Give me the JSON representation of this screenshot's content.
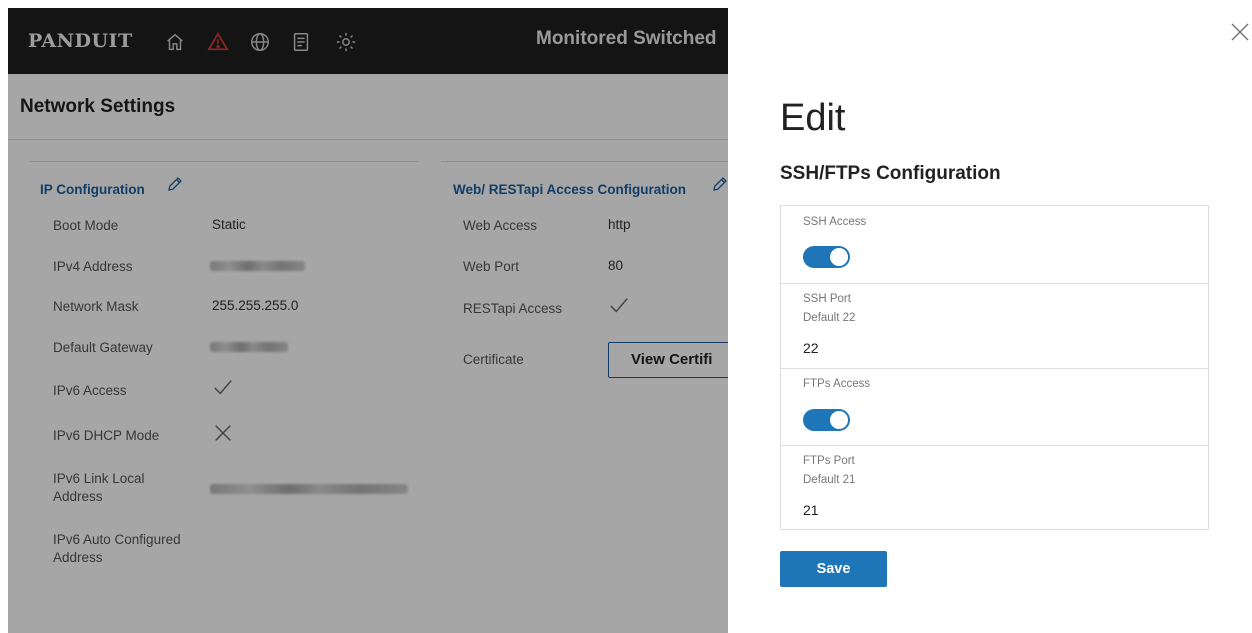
{
  "app": {
    "brand": "PANDUIT",
    "title": "Monitored Switched",
    "nav_icons": [
      "home-icon",
      "alert-icon",
      "globe-icon",
      "document-icon",
      "settings-icon"
    ],
    "alert_color": "#e53935"
  },
  "page": {
    "title": "Network Settings"
  },
  "ip_configuration": {
    "title": "IP Configuration",
    "rows": [
      {
        "label": "Boot Mode",
        "value": "Static"
      },
      {
        "label": "IPv4 Address",
        "value": ""
      },
      {
        "label": "Network Mask",
        "value": "255.255.255.0"
      },
      {
        "label": "Default Gateway",
        "value": ""
      },
      {
        "label": "IPv6 Access",
        "value": "check-icon"
      },
      {
        "label": "IPv6 DHCP Mode",
        "value": "cross-icon"
      },
      {
        "label": "IPv6 Link Local Address",
        "value": ""
      },
      {
        "label": "IPv6 Auto Configured Address",
        "value": ""
      }
    ]
  },
  "web_access": {
    "title": "Web/ RESTapi Access Configuration",
    "rows": [
      {
        "label": "Web Access",
        "value": "http"
      },
      {
        "label": "Web Port",
        "value": "80"
      },
      {
        "label": "RESTapi Access",
        "value": "check-icon"
      },
      {
        "label": "Certificate",
        "value": ""
      }
    ],
    "certificate_button": "View Certifi"
  },
  "edit_panel": {
    "title": "Edit",
    "subtitle": "SSH/FTPs Configuration",
    "ssh_access": {
      "label": "SSH Access",
      "enabled": true
    },
    "ssh_port": {
      "label": "SSH Port",
      "hint": "Default 22",
      "value": "22"
    },
    "ftps_access": {
      "label": "FTPs Access",
      "enabled": true
    },
    "ftps_port": {
      "label": "FTPs Port",
      "hint": "Default 21",
      "value": "21"
    },
    "save_label": "Save",
    "accent": "#1e76b8"
  }
}
